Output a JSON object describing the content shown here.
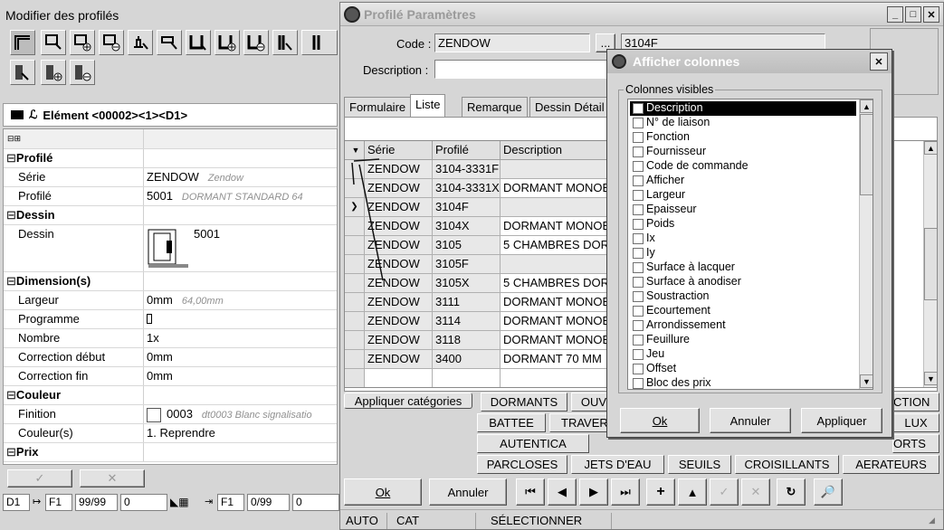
{
  "left": {
    "title": "Modifier des profilés",
    "element": "Elément <00002><1><D1>",
    "props": [
      {
        "label": "Profilé",
        "section": true
      },
      {
        "label": "Série",
        "value": "ZENDOW",
        "hint": "Zendow"
      },
      {
        "label": "Profilé",
        "value": "5001",
        "hint": "DORMANT STANDARD 64"
      },
      {
        "label": "Dessin",
        "section": true
      },
      {
        "label": "Dessin",
        "value": "5001"
      },
      {
        "label": "Dimension(s)",
        "section": true
      },
      {
        "label": "Largeur",
        "value": "0mm",
        "hint": "64,00mm"
      },
      {
        "label": "Programme",
        "value": ""
      },
      {
        "label": "Nombre",
        "value": "1x"
      },
      {
        "label": "Correction début",
        "value": "0mm"
      },
      {
        "label": "Correction fin",
        "value": "0mm"
      },
      {
        "label": "Couleur",
        "section": true
      },
      {
        "label": "Finition",
        "value": "0003",
        "hint": "dt0003 Blanc signalisatio"
      },
      {
        "label": "Couleur(s)",
        "value": "1. Reprendre"
      },
      {
        "label": "Prix",
        "section": true
      }
    ],
    "status": {
      "d": "D1",
      "f1": "F1",
      "count1": "99/99",
      "v1": "0",
      "f2": "F1",
      "count2": "0/99",
      "v2": "0"
    }
  },
  "main": {
    "title": "Profilé Paramètres",
    "code_label": "Code :",
    "code": "ZENDOW",
    "code_btn": "...",
    "code2": "3104F",
    "desc_label": "Description :",
    "tabs": [
      "Formulaire",
      "Liste",
      "Remarque",
      "Dessin Détail"
    ],
    "columns": [
      "Série",
      "Profilé",
      "Description"
    ],
    "rows": [
      [
        "ZENDOW",
        "3104-3331F",
        ""
      ],
      [
        "ZENDOW",
        "3104-3331X",
        "DORMANT MONOB"
      ],
      [
        "ZENDOW",
        "3104F",
        ""
      ],
      [
        "ZENDOW",
        "3104X",
        "DORMANT MONOB"
      ],
      [
        "ZENDOW",
        "3105",
        "5 CHAMBRES DOR"
      ],
      [
        "ZENDOW",
        "3105F",
        ""
      ],
      [
        "ZENDOW",
        "3105X",
        "5 CHAMBRES DOR"
      ],
      [
        "ZENDOW",
        "3111",
        "DORMANT MONOB"
      ],
      [
        "ZENDOW",
        "3114",
        "DORMANT MONOB"
      ],
      [
        "ZENDOW",
        "3118",
        "DORMANT MONOB"
      ],
      [
        "ZENDOW",
        "3400",
        "DORMANT 70 MM"
      ]
    ],
    "categories": {
      "apply": "Appliquer catégories",
      "row1": [
        "DORMANTS",
        "OUV",
        "CTION"
      ],
      "row2": [
        "BATTEE",
        "TRAVER",
        "LUX"
      ],
      "row3": [
        "AUTENTICA",
        "ORTS"
      ],
      "row4": [
        "PARCLOSES",
        "JETS D'EAU",
        "SEUILS",
        "CROISILLANTS",
        "AERATEURS"
      ]
    },
    "ok": "Ok",
    "cancel": "Annuler",
    "status": [
      "AUTO",
      "CAT",
      "SÉLECTIONNER"
    ]
  },
  "cols_dialog": {
    "title": "Afficher colonnes",
    "group": "Colonnes visibles",
    "items": [
      {
        "label": "Description",
        "checked": true
      },
      {
        "label": "N° de liaison",
        "checked": false
      },
      {
        "label": "Fonction",
        "checked": false
      },
      {
        "label": "Fournisseur",
        "checked": false
      },
      {
        "label": "Code de commande",
        "checked": false
      },
      {
        "label": "Afficher",
        "checked": false
      },
      {
        "label": "Largeur",
        "checked": false
      },
      {
        "label": "Epaisseur",
        "checked": false
      },
      {
        "label": "Poids",
        "checked": false
      },
      {
        "label": "Ix",
        "checked": false
      },
      {
        "label": "Iy",
        "checked": false
      },
      {
        "label": "Surface à lacquer",
        "checked": false
      },
      {
        "label": "Surface à anodiser",
        "checked": false
      },
      {
        "label": "Soustraction",
        "checked": false
      },
      {
        "label": "Ecourtement",
        "checked": false
      },
      {
        "label": "Arrondissement",
        "checked": false
      },
      {
        "label": "Feuillure",
        "checked": false
      },
      {
        "label": "Jeu",
        "checked": false
      },
      {
        "label": "Offset",
        "checked": false
      },
      {
        "label": "Bloc des prix",
        "checked": false
      }
    ],
    "ok": "Ok",
    "cancel": "Annuler",
    "apply": "Appliquer"
  }
}
